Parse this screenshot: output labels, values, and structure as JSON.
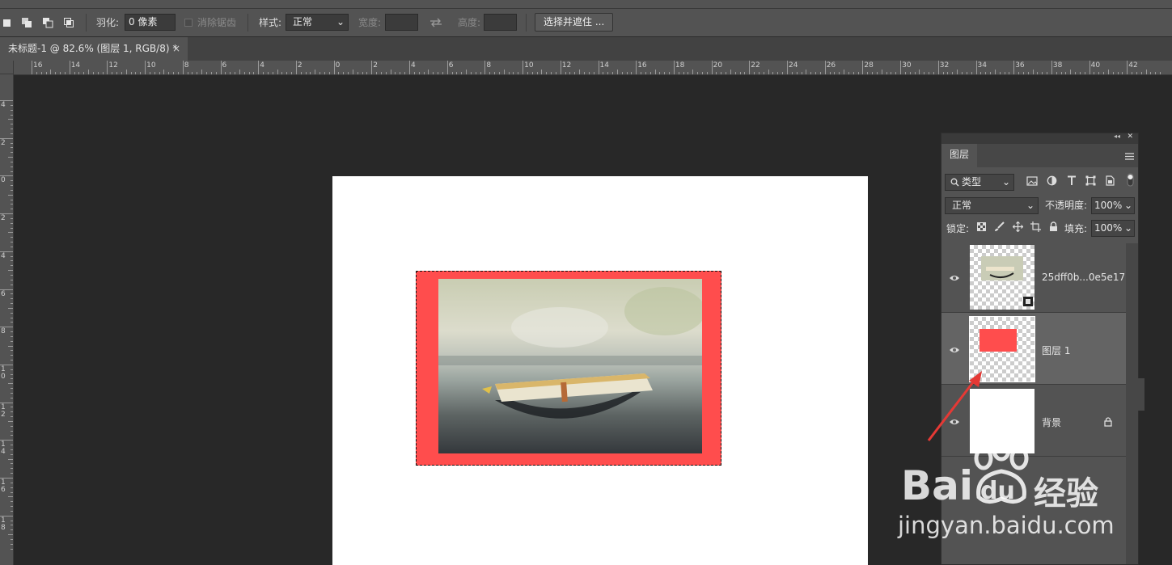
{
  "options_bar": {
    "feather_label": "羽化:",
    "feather_value": "0 像素",
    "antialias_label": "消除锯齿",
    "style_label": "样式:",
    "style_value": "正常",
    "width_label": "宽度:",
    "height_label": "高度:",
    "select_mask_button": "选择并遮住 ..."
  },
  "document_tab": {
    "title": "未标题-1 @ 82.6% (图层 1, RGB/8) *",
    "close": "×"
  },
  "horizontal_ruler_labels": [
    "16",
    "14",
    "12",
    "10",
    "8",
    "6",
    "4",
    "2",
    "0",
    "2",
    "4",
    "6",
    "8",
    "10",
    "12",
    "14",
    "16",
    "18",
    "20",
    "22",
    "24",
    "26",
    "28",
    "30",
    "32",
    "34",
    "36",
    "38",
    "40",
    "42"
  ],
  "vertical_ruler_labels": [
    "4",
    "2",
    "0",
    "2",
    "4",
    "6",
    "8",
    "1\n0",
    "1\n2",
    "1\n4",
    "1\n6",
    "1\n8"
  ],
  "layers_panel": {
    "tab_label": "图层",
    "collapse_glyph": "◂◂",
    "close_glyph": "✕",
    "filter_kind": "类型",
    "blend_mode": "正常",
    "opacity_label": "不透明度:",
    "opacity_value": "100%",
    "lock_label": "锁定:",
    "fill_label": "填充:",
    "fill_value": "100%",
    "layers": [
      {
        "name": "25dff0b...0e5e17",
        "selected": false,
        "locked": false
      },
      {
        "name": "图层 1",
        "selected": true,
        "locked": false
      },
      {
        "name": "背景",
        "selected": false,
        "locked": true
      }
    ]
  },
  "watermark": {
    "brand_left": "Bai",
    "brand_du": "du",
    "brand_right": "经验",
    "url": "jingyan.baidu.com"
  },
  "colors": {
    "red_fill": "#ff4d4d",
    "annotation_arrow": "#e53935",
    "panel_bg": "#535353",
    "workspace_bg": "#282828"
  }
}
